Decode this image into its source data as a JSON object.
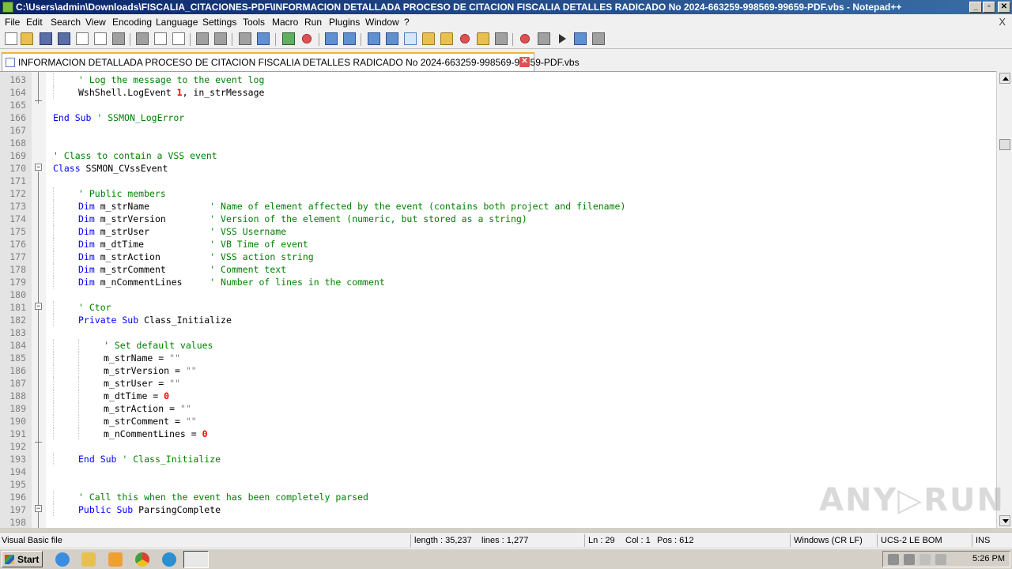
{
  "window": {
    "title": "C:\\Users\\admin\\Downloads\\FISCALIA_CITACIONES-PDF\\INFORMACION DETALLADA PROCESO DE CITACION FISCALIA DETALLES RADICADO No 2024-663259-998569-99659-PDF.vbs - Notepad++",
    "minimize": "_",
    "maximize": "▫",
    "close": "✕"
  },
  "menu": {
    "items": [
      "File",
      "Edit",
      "Search",
      "View",
      "Encoding",
      "Language",
      "Settings",
      "Tools",
      "Macro",
      "Run",
      "Plugins",
      "Window",
      "?"
    ],
    "close": "X"
  },
  "toolbar": {
    "icons": [
      "new-file-icon",
      "open-file-icon",
      "save-icon",
      "save-all-icon",
      "close-icon",
      "close-all-icon",
      "print-icon",
      "cut-icon",
      "copy-icon",
      "paste-icon",
      "undo-icon",
      "redo-icon",
      "find-icon",
      "replace-icon",
      "zoom-in-icon",
      "zoom-out-icon",
      "sync-vertical-icon",
      "sync-horizontal-icon",
      "word-wrap-icon",
      "show-all-characters-icon",
      "indent-guide-icon",
      "user-language-icon",
      "document-map-icon",
      "function-list-icon",
      "folder-as-workspace-icon",
      "monitoring-icon",
      "record-macro-icon",
      "stop-macro-icon",
      "play-macro-icon",
      "run-macro-multiple-icon",
      "save-macro-icon"
    ]
  },
  "tab": {
    "label": "INFORMACION DETALLADA PROCESO DE CITACION FISCALIA DETALLES RADICADO No 2024-663259-998569-99659-PDF.vbs",
    "close": "✕"
  },
  "editor": {
    "lines": [
      {
        "n": "163",
        "indent": 1,
        "parts": [
          [
            "cm",
            "' Log the message to the event log"
          ]
        ]
      },
      {
        "n": "164",
        "indent": 1,
        "parts": [
          [
            "id",
            "WshShell.LogEvent "
          ],
          [
            "num",
            "1"
          ],
          [
            "id",
            ", in_strMessage"
          ]
        ]
      },
      {
        "n": "165",
        "indent": 0,
        "parts": []
      },
      {
        "n": "166",
        "indent": 0,
        "parts": [
          [
            "kw",
            "End Sub"
          ],
          [
            "id",
            " "
          ],
          [
            "cm",
            "' SSMON_LogError"
          ]
        ]
      },
      {
        "n": "167",
        "indent": 0,
        "parts": []
      },
      {
        "n": "168",
        "indent": 0,
        "parts": []
      },
      {
        "n": "169",
        "indent": 0,
        "parts": [
          [
            "cm",
            "' Class to contain a VSS event"
          ]
        ]
      },
      {
        "n": "170",
        "indent": 0,
        "parts": [
          [
            "kw",
            "Class"
          ],
          [
            "id",
            " SSMON_CVssEvent"
          ]
        ]
      },
      {
        "n": "171",
        "indent": 0,
        "parts": []
      },
      {
        "n": "172",
        "indent": 1,
        "parts": [
          [
            "cm",
            "' Public members"
          ]
        ]
      },
      {
        "n": "173",
        "indent": 1,
        "parts": [
          [
            "kw",
            "Dim"
          ],
          [
            "id",
            " m_strName           "
          ],
          [
            "cm",
            "' Name of element affected by the event (contains both project and filename)"
          ]
        ]
      },
      {
        "n": "174",
        "indent": 1,
        "parts": [
          [
            "kw",
            "Dim"
          ],
          [
            "id",
            " m_strVersion        "
          ],
          [
            "cm",
            "' Version of the element (numeric, but stored as a string)"
          ]
        ]
      },
      {
        "n": "175",
        "indent": 1,
        "parts": [
          [
            "kw",
            "Dim"
          ],
          [
            "id",
            " m_strUser           "
          ],
          [
            "cm",
            "' VSS Username"
          ]
        ]
      },
      {
        "n": "176",
        "indent": 1,
        "parts": [
          [
            "kw",
            "Dim"
          ],
          [
            "id",
            " m_dtTime            "
          ],
          [
            "cm",
            "' VB Time of event"
          ]
        ]
      },
      {
        "n": "177",
        "indent": 1,
        "parts": [
          [
            "kw",
            "Dim"
          ],
          [
            "id",
            " m_strAction         "
          ],
          [
            "cm",
            "' VSS action string"
          ]
        ]
      },
      {
        "n": "178",
        "indent": 1,
        "parts": [
          [
            "kw",
            "Dim"
          ],
          [
            "id",
            " m_strComment        "
          ],
          [
            "cm",
            "' Comment text"
          ]
        ]
      },
      {
        "n": "179",
        "indent": 1,
        "parts": [
          [
            "kw",
            "Dim"
          ],
          [
            "id",
            " m_nCommentLines     "
          ],
          [
            "cm",
            "' Number of lines in the comment"
          ]
        ]
      },
      {
        "n": "180",
        "indent": 0,
        "parts": []
      },
      {
        "n": "181",
        "indent": 1,
        "parts": [
          [
            "cm",
            "' Ctor"
          ]
        ]
      },
      {
        "n": "182",
        "indent": 1,
        "parts": [
          [
            "kw",
            "Private Sub"
          ],
          [
            "id",
            " Class_Initialize"
          ]
        ]
      },
      {
        "n": "183",
        "indent": 0,
        "parts": []
      },
      {
        "n": "184",
        "indent": 2,
        "parts": [
          [
            "cm",
            "' Set default values"
          ]
        ]
      },
      {
        "n": "185",
        "indent": 2,
        "parts": [
          [
            "id",
            "m_strName = "
          ],
          [
            "str",
            "\"\""
          ]
        ]
      },
      {
        "n": "186",
        "indent": 2,
        "parts": [
          [
            "id",
            "m_strVersion = "
          ],
          [
            "str",
            "\"\""
          ]
        ]
      },
      {
        "n": "187",
        "indent": 2,
        "parts": [
          [
            "id",
            "m_strUser = "
          ],
          [
            "str",
            "\"\""
          ]
        ]
      },
      {
        "n": "188",
        "indent": 2,
        "parts": [
          [
            "id",
            "m_dtTime = "
          ],
          [
            "num",
            "0"
          ]
        ]
      },
      {
        "n": "189",
        "indent": 2,
        "parts": [
          [
            "id",
            "m_strAction = "
          ],
          [
            "str",
            "\"\""
          ]
        ]
      },
      {
        "n": "190",
        "indent": 2,
        "parts": [
          [
            "id",
            "m_strComment = "
          ],
          [
            "str",
            "\"\""
          ]
        ]
      },
      {
        "n": "191",
        "indent": 2,
        "parts": [
          [
            "id",
            "m_nCommentLines = "
          ],
          [
            "num",
            "0"
          ]
        ]
      },
      {
        "n": "192",
        "indent": 0,
        "parts": []
      },
      {
        "n": "193",
        "indent": 1,
        "parts": [
          [
            "kw",
            "End Sub"
          ],
          [
            "id",
            " "
          ],
          [
            "cm",
            "' Class_Initialize"
          ]
        ]
      },
      {
        "n": "194",
        "indent": 0,
        "parts": []
      },
      {
        "n": "195",
        "indent": 0,
        "parts": []
      },
      {
        "n": "196",
        "indent": 1,
        "parts": [
          [
            "cm",
            "' Call this when the event has been completely parsed"
          ]
        ]
      },
      {
        "n": "197",
        "indent": 1,
        "parts": [
          [
            "kw",
            "Public Sub"
          ],
          [
            "id",
            " ParsingComplete"
          ]
        ]
      },
      {
        "n": "198",
        "indent": 0,
        "parts": []
      }
    ]
  },
  "watermark": "ANY▷RUN",
  "status": {
    "language": "Visual Basic file",
    "length": "length : 35,237",
    "lines": "lines : 1,277",
    "ln": "Ln : 29",
    "col": "Col : 1",
    "pos": "Pos : 612",
    "eol": "Windows (CR LF)",
    "encoding": "UCS-2 LE BOM",
    "mode": "INS"
  },
  "taskbar": {
    "start": "Start",
    "apps": [
      "internet-explorer-icon",
      "explorer-icon",
      "media-player-icon",
      "chrome-icon",
      "edge-icon",
      "notepadpp-icon"
    ],
    "clock": "5:26 PM"
  },
  "colors": {
    "keyword": "#0000ff",
    "comment": "#008000",
    "number": "#ff0000",
    "string": "#808080",
    "titlebar": "#0a246a"
  }
}
